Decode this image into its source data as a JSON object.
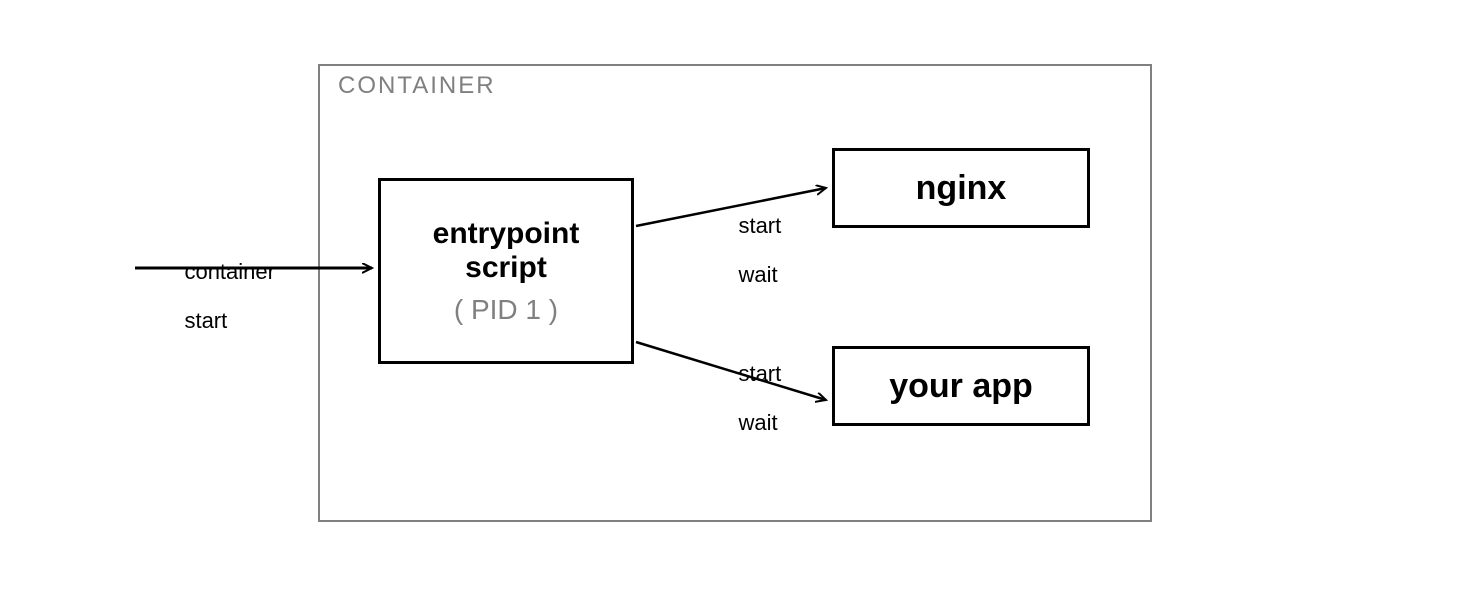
{
  "diagram": {
    "container_label": "CONTAINER",
    "entrypoint": {
      "line1": "entrypoint",
      "line2": "script",
      "subtitle": "( PID 1 )"
    },
    "nginx_label": "nginx",
    "app_label": "your app",
    "edges": {
      "container_start": {
        "line1": "container",
        "line2": "start"
      },
      "to_nginx": {
        "line1": "start",
        "line2": "wait"
      },
      "to_app": {
        "line1": "start",
        "line2": "wait"
      }
    }
  }
}
